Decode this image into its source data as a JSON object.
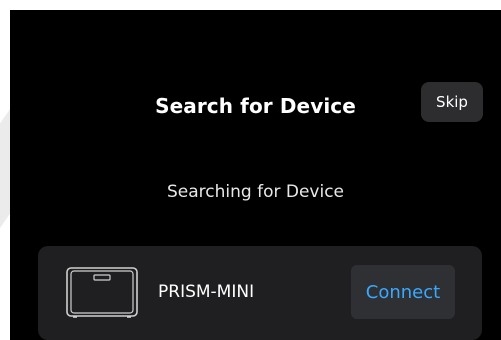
{
  "header": {
    "title": "Search for Device",
    "skip_label": "Skip"
  },
  "status": {
    "text": "Searching for Device"
  },
  "device_list": {
    "items": [
      {
        "name": "PRISM-MINI",
        "icon": "printer-icon",
        "action_label": "Connect"
      }
    ]
  },
  "colors": {
    "background": "#000000",
    "card": "#1f1f21",
    "button": "#2d2d2f",
    "accent": "#3aa8ff"
  }
}
